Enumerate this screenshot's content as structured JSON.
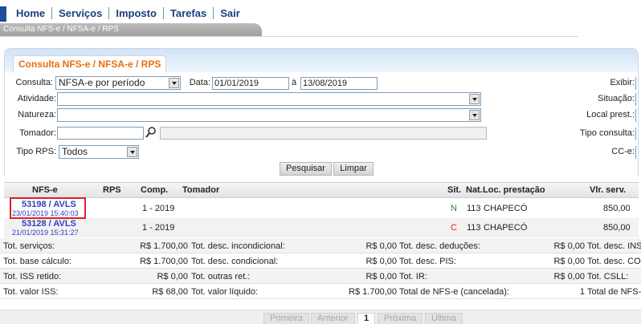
{
  "nav": {
    "items": [
      "Home",
      "Serviços",
      "Imposto",
      "Tarefas",
      "Sair"
    ]
  },
  "breadcrumb": "Consulta NFS-e / NFSA-e / RPS",
  "panel": {
    "title": "Consulta NFS-e / NFSA-e / RPS"
  },
  "form": {
    "consulta_label": "Consulta:",
    "consulta_value": "NFSA-e por período",
    "data_label": "Data:",
    "data_from": "01/01/2019",
    "data_to_label": "à",
    "data_to": "13/08/2019",
    "atividade_label": "Atividade:",
    "atividade_value": "",
    "natureza_label": "Natureza:",
    "natureza_value": "",
    "tomador_label": "Tomador:",
    "tomador_value": "",
    "tomador_name": "",
    "tipo_rps_label": "Tipo RPS:",
    "tipo_rps_value": "Todos",
    "exibir_label": "Exibir:",
    "situacao_label": "Situação:",
    "local_prest_label": "Local prest.:",
    "tipo_consulta_label": "Tipo consulta:",
    "cce_label": "CC-e:",
    "pesquisar": "Pesquisar",
    "limpar": "Limpar"
  },
  "grid": {
    "headers": {
      "nfse": "NFS-e",
      "rps": "RPS",
      "comp": "Comp.",
      "tomador": "Tomador",
      "sit": "Sit.",
      "nat": "Nat.",
      "loc": "Loc. prestação",
      "vlr": "Vlr. serv."
    },
    "rows": [
      {
        "nfse": "53198 / AVLS",
        "datetime": "23/01/2019 15:40:03",
        "rps": "",
        "comp": "1 - 2019",
        "tomador": "",
        "sit": "N",
        "nat": "113",
        "loc": "CHAPECÓ",
        "vlr": "850,00"
      },
      {
        "nfse": "53128 / AVLS",
        "datetime": "21/01/2019 15:31:27",
        "rps": "",
        "comp": "1 - 2019",
        "tomador": "",
        "sit": "C",
        "nat": "113",
        "loc": "CHAPECÓ",
        "vlr": "850,00"
      }
    ]
  },
  "totals": {
    "rows": [
      [
        [
          "Tot. serviços:",
          "R$ 1.700,00"
        ],
        [
          "Tot. desc. incondicional:",
          "R$ 0,00"
        ],
        [
          "Tot. desc. deduções:",
          "R$ 0,00"
        ],
        [
          "Tot. desc. INS",
          ""
        ]
      ],
      [
        [
          "Tot. base cálculo:",
          "R$ 1.700,00"
        ],
        [
          "Tot. desc. condicional:",
          "R$ 0,00"
        ],
        [
          "Tot. desc. PIS:",
          "R$ 0,00"
        ],
        [
          "Tot. desc. COF",
          ""
        ]
      ],
      [
        [
          "Tot. ISS retido:",
          "R$ 0,00"
        ],
        [
          "Tot. outras ret.:",
          "R$ 0,00"
        ],
        [
          "Tot. IR:",
          "R$ 0,00"
        ],
        [
          "Tot. CSLL:",
          ""
        ]
      ],
      [
        [
          "Tot. valor ISS:",
          "R$ 68,00"
        ],
        [
          "Tot. valor líquido:",
          "R$ 1.700,00"
        ],
        [
          "Total de NFS-e (cancelada):",
          "1"
        ],
        [
          "Total de NFS-e",
          ""
        ]
      ]
    ]
  },
  "pager": {
    "first": "Primeira",
    "prev": "Anterior",
    "current": "1",
    "next": "Próxima",
    "last": "Última"
  },
  "colors": {
    "nav_text": "#1b3f7a",
    "title_orange": "#e86f0c",
    "link_blue": "#2f3fbf",
    "highlight_red": "#e02020"
  }
}
